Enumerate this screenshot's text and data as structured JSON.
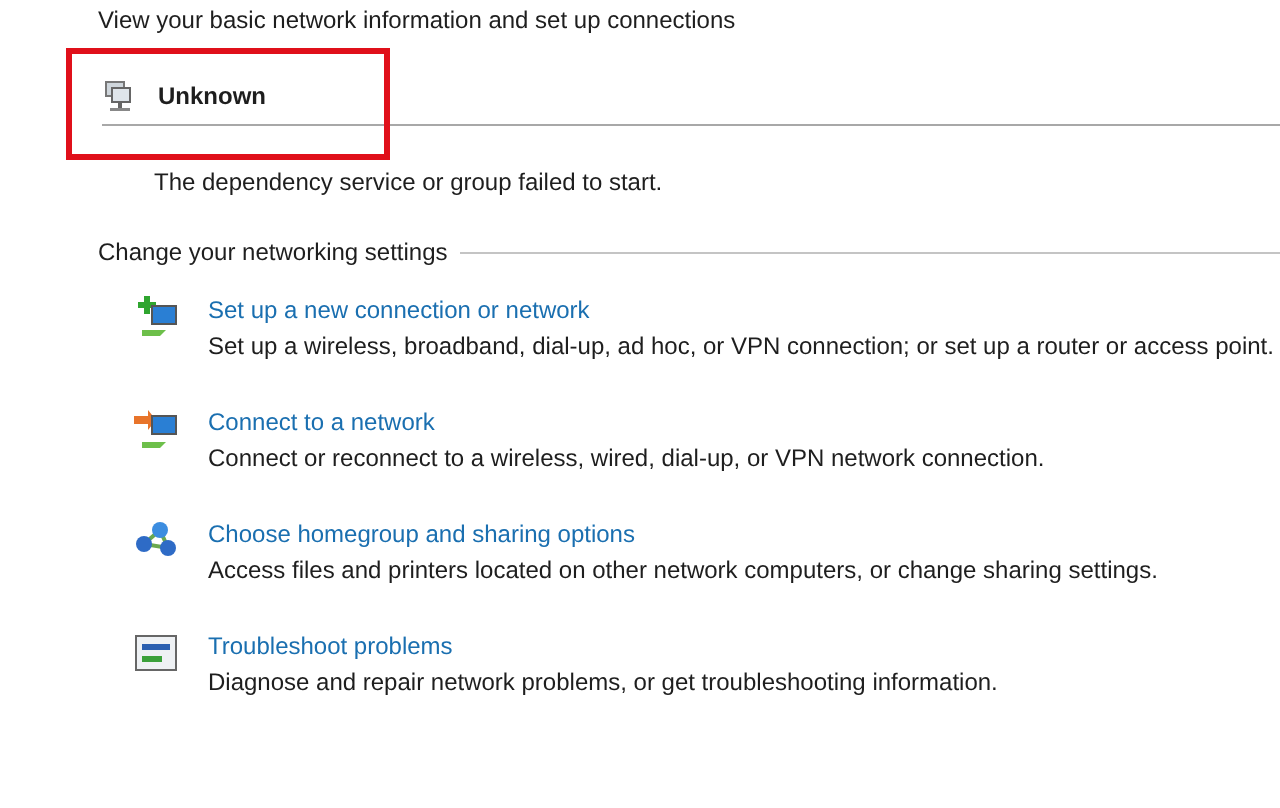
{
  "heading": "View your basic network information and set up connections",
  "network": {
    "name": "Unknown",
    "message": "The dependency service or group failed to start.",
    "highlighted": true
  },
  "section": {
    "title": "Change your networking settings",
    "tasks": [
      {
        "kind": "add",
        "link": "Set up a new connection or network",
        "description": "Set up a wireless, broadband, dial-up, ad hoc, or VPN connection; or set up a router or access point."
      },
      {
        "kind": "connect",
        "link": "Connect to a network",
        "description": "Connect or reconnect to a wireless, wired, dial-up, or VPN network connection."
      },
      {
        "kind": "share",
        "link": "Choose homegroup and sharing options",
        "description": "Access files and printers located on other network computers, or change sharing settings."
      },
      {
        "kind": "repair",
        "link": "Troubleshoot problems",
        "description": "Diagnose and repair network problems, or get troubleshooting information."
      }
    ]
  }
}
